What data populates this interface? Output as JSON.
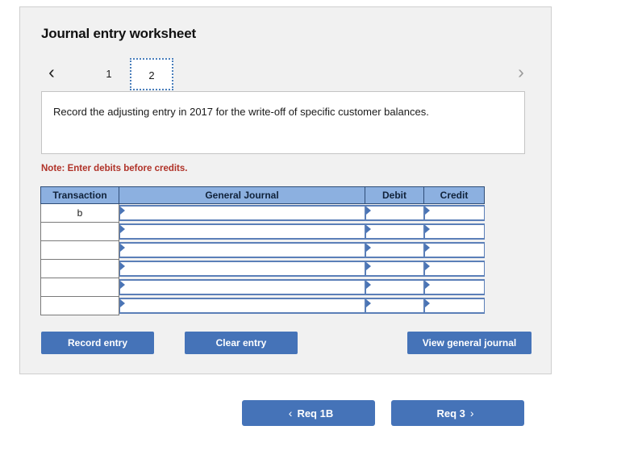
{
  "panel": {
    "title": "Journal entry worksheet",
    "tabs": {
      "prev_icon": "chevron-left-icon",
      "prev_glyph": "‹",
      "next_icon": "chevron-right-icon",
      "next_glyph": "›",
      "items": [
        {
          "label": "1",
          "selected": false
        },
        {
          "label": "2",
          "selected": true
        }
      ]
    },
    "instruction": "Record the adjusting entry in 2017 for the write-off of specific customer balances.",
    "note": "Note: Enter debits before credits."
  },
  "table": {
    "headers": [
      "Transaction",
      "General Journal",
      "Debit",
      "Credit"
    ],
    "rows": [
      {
        "transaction": "b",
        "general_journal": "",
        "debit": "",
        "credit": ""
      },
      {
        "transaction": "",
        "general_journal": "",
        "debit": "",
        "credit": ""
      },
      {
        "transaction": "",
        "general_journal": "",
        "debit": "",
        "credit": ""
      },
      {
        "transaction": "",
        "general_journal": "",
        "debit": "",
        "credit": ""
      },
      {
        "transaction": "",
        "general_journal": "",
        "debit": "",
        "credit": ""
      },
      {
        "transaction": "",
        "general_journal": "",
        "debit": "",
        "credit": ""
      }
    ],
    "cell_marker_icon": "triangle-right-icon"
  },
  "actions": {
    "record_entry": "Record entry",
    "clear_entry": "Clear entry",
    "view_general_journal": "View general journal"
  },
  "requirement_nav": {
    "prev_label": "Req 1B",
    "prev_arrow": "‹",
    "prev_icon": "chevron-left-icon",
    "next_label": "Req 3",
    "next_arrow": "›",
    "next_icon": "chevron-right-icon"
  },
  "colors": {
    "panel_background": "#f1f1f1",
    "table_header_blue": "#8cb0e0",
    "button_blue": "#4573b8",
    "note_red": "#b03228",
    "input_border_blue": "#5b7fb8",
    "tab_selected_border": "#4a7ebb"
  }
}
